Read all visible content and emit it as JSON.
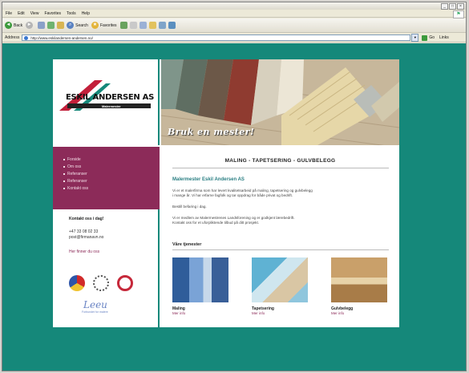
{
  "browser": {
    "menu": [
      "File",
      "Edit",
      "View",
      "Favorites",
      "Tools",
      "Help"
    ],
    "toolbar": {
      "back": "Back",
      "search": "Search",
      "favorites": "Favorites"
    },
    "address_label": "Address",
    "address": "http://www.eskilandersen-andersen.no/",
    "go": "Go",
    "links": "Links"
  },
  "site": {
    "logo_name": "ESKIL ANDERSEN AS",
    "logo_tag": "Malermester",
    "hero_text": "Bruk en mester!",
    "nav": [
      "Forside",
      "Om oss",
      "Referanser",
      "Referanser",
      "Kontakt oss"
    ],
    "contact": {
      "heading": "Kontakt oss i dag!",
      "phone": "+47 33 08 02 33",
      "email": "post@firmanavn.no",
      "map": "Her finner du oss"
    },
    "signature": "Leeu",
    "signature_sub": "Forbundet for malere",
    "headline": "MALING - TAPETSERING - GULVBELEGG",
    "subheading": "Malermester Eskil Andersen AS",
    "para1a": "Vi er et malerfirma som har levert kvalitetsarbeid på maling, tapetsering og gulvbelegg",
    "para1b": "i mange år. Vi har erfarne fagfolk og tar oppdrag for både privat og bedrift.",
    "para2": "Bestill befaring i dag.",
    "para3a": "Vi er medlem av Malermestrenes Landsforening og er godkjent lærebedrift.",
    "para3b": "Kontakt oss for et uforpliktende tilbud på ditt prosjekt.",
    "services_heading": "Våre tjenester",
    "services": [
      {
        "name": "Maling",
        "more": "Mer info"
      },
      {
        "name": "Tapetsering",
        "more": "Mer info"
      },
      {
        "name": "Gulvbelegg",
        "more": "Mer info"
      }
    ]
  },
  "colors": {
    "teal": "#15887a",
    "plum": "#8c2b59",
    "link": "#2b7f83"
  }
}
